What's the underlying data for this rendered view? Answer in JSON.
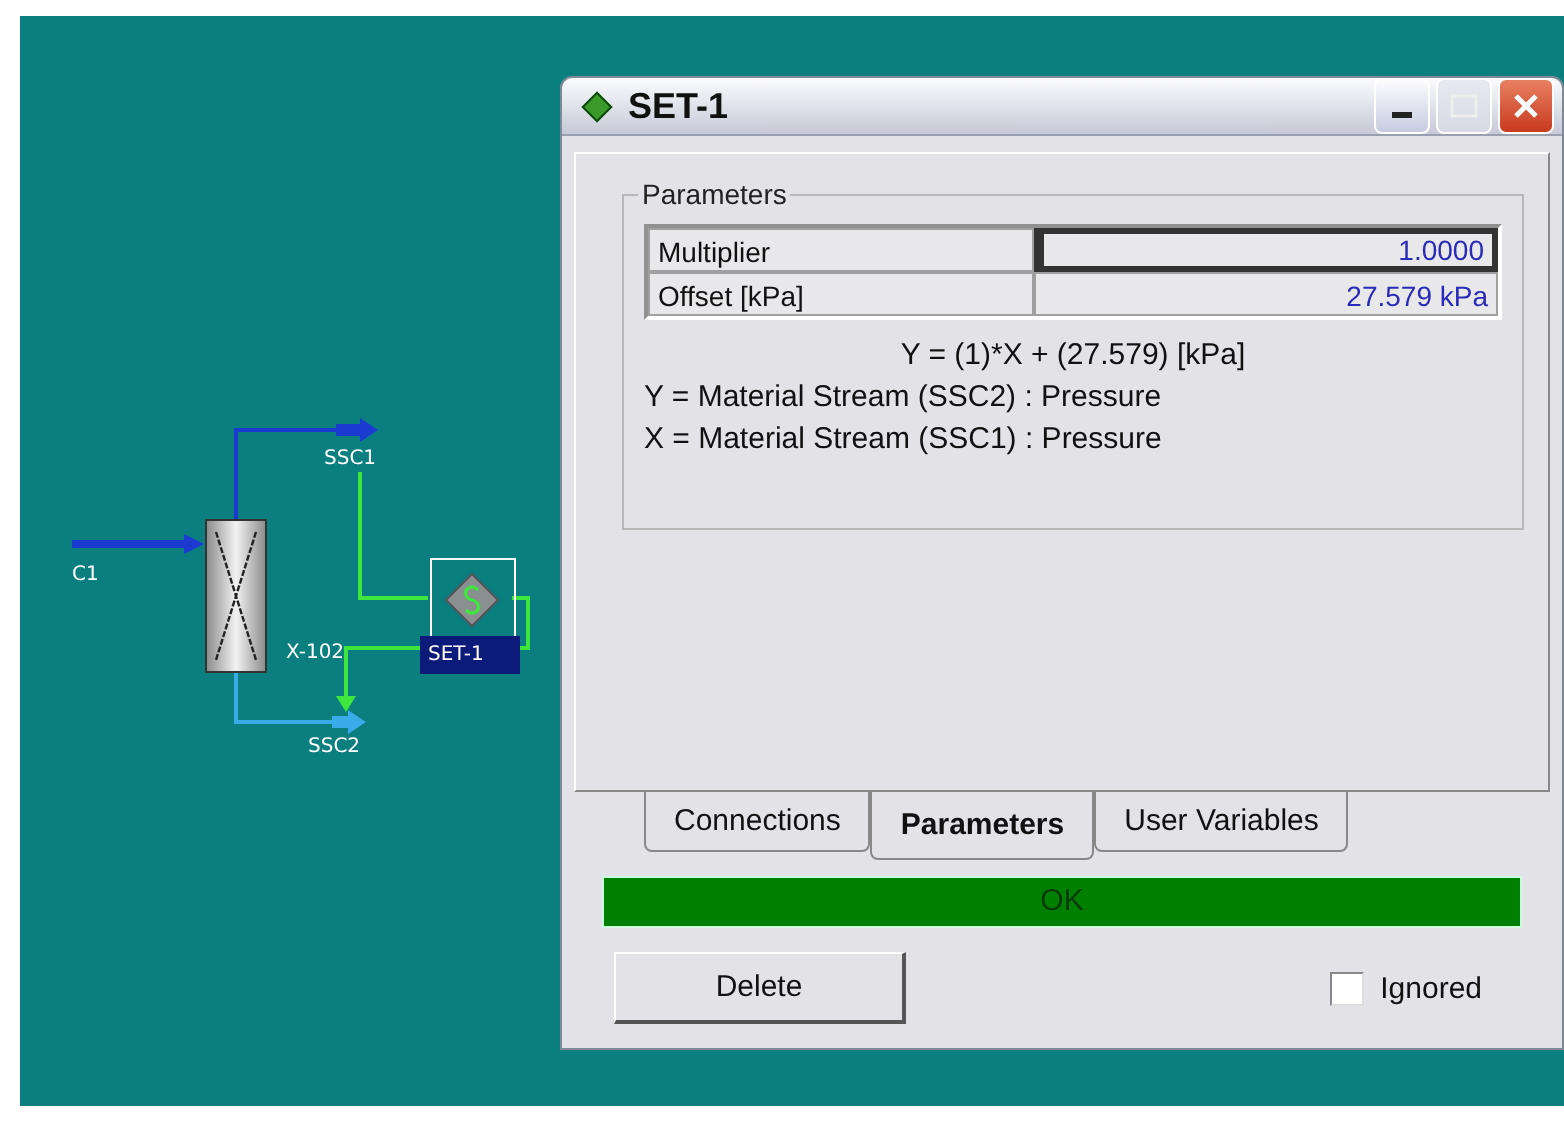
{
  "diagram": {
    "streams": [
      {
        "label": "C1"
      },
      {
        "label": "SSC1"
      },
      {
        "label": "SSC2"
      }
    ],
    "units": [
      {
        "label": "X-102"
      },
      {
        "label": "SET-1"
      }
    ]
  },
  "window": {
    "title": "SET-1"
  },
  "parameters": {
    "title": "Parameters",
    "rows": [
      {
        "label": "Multiplier",
        "value": "1.0000",
        "selected": true
      },
      {
        "label": "Offset [kPa]",
        "value": "27.579 kPa",
        "selected": false
      }
    ],
    "equation": "Y = (1)*X + (27.579) [kPa]",
    "definitions": [
      "Y = Material Stream (SSC2) : Pressure",
      "X = Material Stream (SSC1) : Pressure"
    ]
  },
  "tabs": [
    {
      "label": "Connections",
      "selected": false
    },
    {
      "label": "Parameters",
      "selected": true
    },
    {
      "label": "User Variables",
      "selected": false
    }
  ],
  "status": {
    "text": "OK",
    "color": "#008000"
  },
  "buttons": [
    {
      "label": "Delete"
    }
  ],
  "ignored": {
    "label": "Ignored",
    "checked": false
  }
}
